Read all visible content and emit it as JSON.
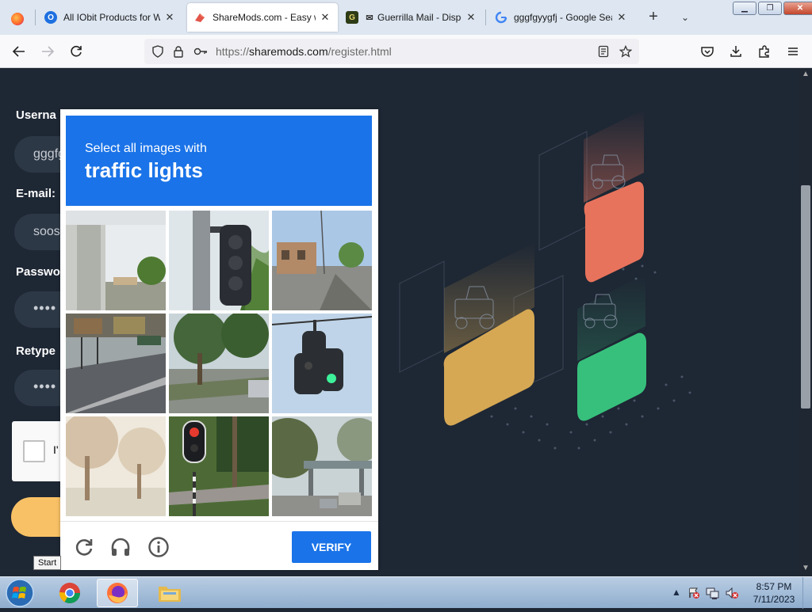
{
  "browser": {
    "tabs": [
      {
        "title": "All IObit Products for Wir",
        "favicon": "iobit-icon",
        "active": false
      },
      {
        "title": "ShareMods.com - Easy w",
        "favicon": "sharemods-icon",
        "active": true
      },
      {
        "title": "Guerrilla Mail - Dispos",
        "favicon": "guerrilla-icon",
        "active": false
      },
      {
        "title": "gggfgyygfj - Google Sear",
        "favicon": "google-icon",
        "active": false
      }
    ],
    "close_glyph": "✕",
    "new_tab_glyph": "+",
    "tab_list_glyph": "⌄",
    "url_scheme": "https://",
    "url_host": "sharemods.com",
    "url_path": "/register.html"
  },
  "form": {
    "username_label": "Userna",
    "username_value": "gggfg",
    "email_label": "E-mail:",
    "email_value": "soos",
    "password_label": "Passwo",
    "password_value": "••••",
    "retype_label": "Retype",
    "retype_value": "••••",
    "robot_text": "I'"
  },
  "captcha": {
    "instruction": "Select all images with",
    "target": "traffic lights",
    "verify_label": "VERIFY",
    "accent": "#1a73e8"
  },
  "tooltip": "Start",
  "taskbar": {
    "time": "8:57 PM",
    "date": "7/11/2023"
  },
  "colors": {
    "page_bg": "#1e2734",
    "submit": "#f9c165",
    "card_red": "#e8735c",
    "card_yellow": "#d6a854",
    "card_green": "#37c07c"
  }
}
